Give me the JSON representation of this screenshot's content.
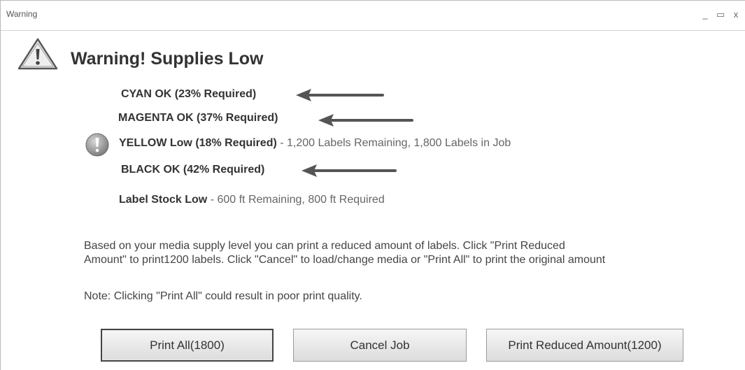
{
  "window": {
    "title": "Warning",
    "controls": {
      "minimize": "_",
      "maximize": "▭",
      "close": "x"
    }
  },
  "heading": "Warning!  Supplies Low",
  "icons": {
    "header": "warning-triangle-icon",
    "yellow_status": "exclamation-icon",
    "arrows": "arrow-left-icon"
  },
  "supplies": {
    "cyan": {
      "label": "CYAN OK (23% Required)"
    },
    "magenta": {
      "label": "MAGENTA OK (37% Required)"
    },
    "yellow": {
      "label": "YELLOW Low (18% Required)",
      "detail": " - 1,200 Labels Remaining, 1,800 Labels in Job"
    },
    "black": {
      "label": "BLACK OK (42% Required)"
    },
    "stock": {
      "label": "Label Stock Low",
      "detail": "  - 600 ft Remaining, 800 ft Required"
    }
  },
  "message": {
    "line1": "Based on your media supply level you can print a reduced amount of labels. Click \"Print Reduced",
    "line2": "Amount\" to print1200 labels. Click \"Cancel\" to load/change media or \"Print All\" to print the original amount",
    "note": "Note: Clicking \"Print All\" could result in poor print quality."
  },
  "buttons": {
    "print_all": "Print All(1800)",
    "cancel": "Cancel Job",
    "print_reduced": "Print Reduced Amount(1200)"
  },
  "colors": {
    "arrow": "#555555",
    "text_dark": "#333333",
    "text_muted": "#666666",
    "default_button_border": "#444444"
  }
}
